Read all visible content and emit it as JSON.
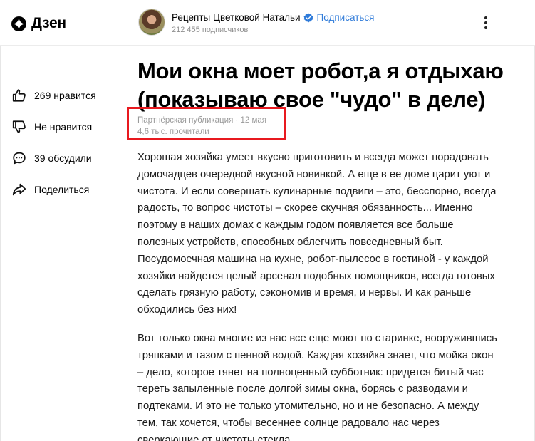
{
  "header": {
    "logo_text": "Дзен",
    "channel": {
      "name": "Рецепты Цветковой Натальи",
      "subscribe_label": "Подписаться",
      "subscribers": "212 455 подписчиков"
    }
  },
  "sidebar": {
    "actions": [
      {
        "icon": "thumbs-up-icon",
        "label": "269 нравится"
      },
      {
        "icon": "thumbs-down-icon",
        "label": "Не нравится"
      },
      {
        "icon": "comments-icon",
        "label": "39 обсудили"
      },
      {
        "icon": "share-icon",
        "label": "Поделиться"
      }
    ]
  },
  "article": {
    "title": "Мои окна моет робот,а я отдыхаю (показываю свое \"чудо\" в деле)",
    "meta_line1": "Партнёрская публикация · 12 мая",
    "meta_line2": "4,6 тыс. прочитали",
    "paragraphs": [
      "Хорошая хозяйка умеет вкусно приготовить и всегда может порадовать домочадцев очередной вкусной новинкой. А еще в ее доме царит уют и чистота. И если совершать кулинарные подвиги – это, бесспорно, всегда радость, то вопрос чистоты – скорее скучная обязанность... Именно поэтому в наших домах с каждым годом появляется все больше полезных устройств, способных облегчить повседневный быт. Посудомоечная машина на кухне, робот-пылесос в гостиной - у каждой хозяйки найдется целый арсенал подобных помощников, всегда готовых сделать грязную работу, сэкономив и время, и нервы. И как раньше обходились без них!",
      "Вот только окна многие из нас все еще моют по старинке, вооружившись тряпками и тазом с пенной водой. Каждая хозяйка знает, что мойка окон – дело, которое тянет на полноценный субботник: придется битый час тереть запыленные после долгой зимы окна, борясь с разводами и подтеками. И это не только утомительно, но и не безопасно. А между тем, так хочется, чтобы весеннее солнце радовало нас через сверкающие от чистоты стекла."
    ]
  },
  "colors": {
    "link": "#2f7bd9",
    "highlight_border": "#e8191f",
    "muted_text": "#9a9a9a"
  }
}
